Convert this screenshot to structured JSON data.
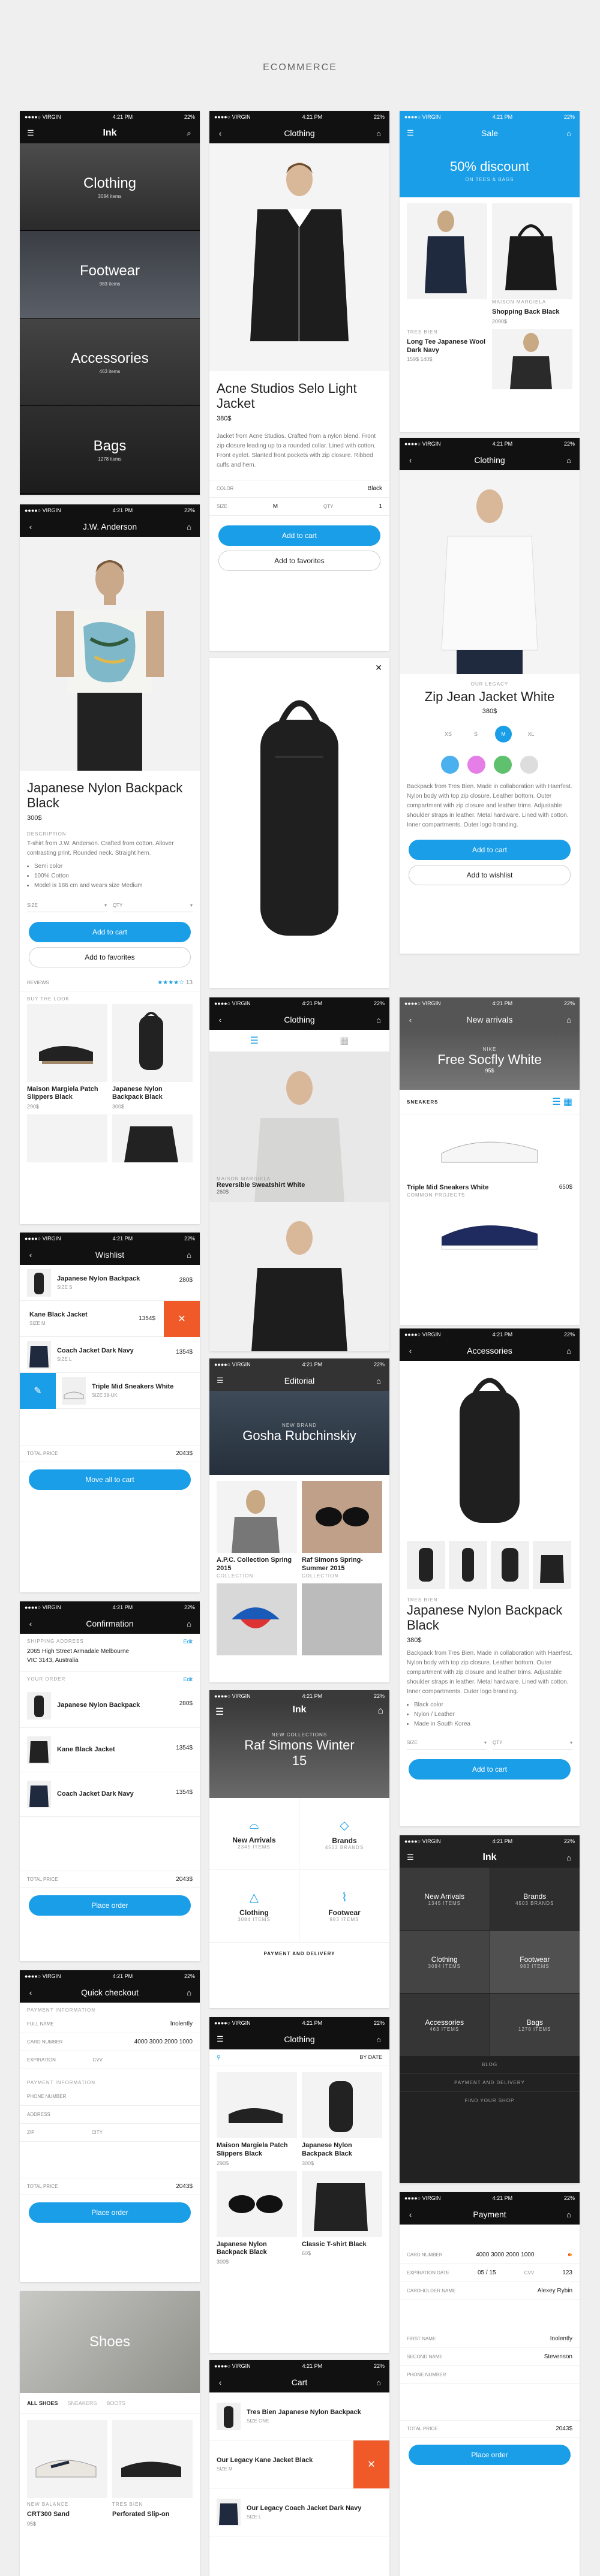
{
  "page_title": "ECOMMERCE",
  "status": {
    "carrier": "●●●●○ VIRGIN",
    "time": "4:21 PM",
    "battery": "22%"
  },
  "brand": "Ink",
  "categories_screen": {
    "items": [
      {
        "name": "Clothing",
        "count": "3084 items"
      },
      {
        "name": "Footwear",
        "count": "983 items"
      },
      {
        "name": "Accessories",
        "count": "463 items"
      },
      {
        "name": "Bags",
        "count": "1278 items"
      }
    ]
  },
  "product_screen": {
    "nav_title": "J.W. Anderson",
    "title": "Japanese Nylon Backpack Black",
    "price": "300$",
    "desc_label": "DESCRIPTION",
    "desc": "T-shirt from J.W. Anderson. Crafted from cotton. Allover contrasting print. Rounded neck. Straight hem.",
    "bullets": [
      "Semi color",
      "100% Cotton",
      "Model is 186 cm and wears size Medium"
    ],
    "size_label": "SIZE",
    "qty_label": "QTY",
    "add_cart": "Add to cart",
    "add_fav": "Add to favorites",
    "reviews_label": "REVIEWS",
    "reviews_count": "13",
    "look_label": "BUY THE LOOK",
    "look_items": [
      {
        "name": "Maison Margiela Patch Slippers Black",
        "price": "290$"
      },
      {
        "name": "Japanese Nylon Backpack Black",
        "price": "300$"
      }
    ]
  },
  "wishlist_screen": {
    "nav_title": "Wishlist",
    "items": [
      {
        "name": "Japanese Nylon Backpack",
        "sub": "SIZE S",
        "price": "280$"
      },
      {
        "name": "Kane Black Jacket",
        "sub": "SIZE M",
        "price": "1354$"
      },
      {
        "name": "Coach Jacket Dark Navy",
        "sub": "SIZE L",
        "price": "1354$"
      },
      {
        "name": "Triple Mid Sneakers White",
        "sub": "SIZE 38-UK",
        "price": ""
      }
    ],
    "total_label": "TOTAL PRICE",
    "total": "2043$",
    "move_all": "Move all to cart"
  },
  "confirm_screen": {
    "nav_title": "Confirmation",
    "shipping_label": "SHIPPING ADDRESS",
    "edit": "Edit",
    "address": "2065 High Street Armadale Melbourne VIC 3143, Australia",
    "order_label": "YOUR ORDER",
    "items": [
      {
        "name": "Japanese Nylon Backpack",
        "price": "280$"
      },
      {
        "name": "Kane Black Jacket",
        "price": "1354$"
      },
      {
        "name": "Coach Jacket Dark Navy",
        "price": "1354$"
      }
    ],
    "total_label": "TOTAL PRICE",
    "total": "2043$",
    "place": "Place order"
  },
  "quick_screen": {
    "nav_title": "Quick checkout",
    "payment_label": "PAYMENT INFORMATION",
    "full_name_label": "FULL NAME",
    "full_name": "Inolently",
    "card_label": "CARD NUMBER",
    "card": "4000 3000 2000 1000",
    "exp_label": "EXPIRATION",
    "cvv_label": "CVV",
    "ship_label": "PAYMENT INFORMATION",
    "phone_label": "PHONE NUMBER",
    "address_label": "ADDRESS",
    "zip_label": "ZIP",
    "city_label": "CITY",
    "total_label": "TOTAL PRICE",
    "total": "2043$",
    "place": "Place order"
  },
  "shoes_screen": {
    "hero": "Shoes",
    "tabs": [
      "ALL SHOES",
      "SNEAKERS",
      "BOOTS"
    ],
    "items": [
      {
        "brand": "NEW BALANCE",
        "name": "CRT300 Sand",
        "price": "95$"
      },
      {
        "brand": "TRES BIEN",
        "name": "Perforated Slip-on",
        "price": ""
      }
    ]
  },
  "jacket_screen": {
    "nav_title": "Clothing",
    "title": "Acne Studios Selo Light Jacket",
    "price": "380$",
    "desc": "Jacket from Acne Studios. Crafted from a nylon blend. Front zip closure leading up to a rounded collar. Lined with cotton. Front eyelet. Slanted front pockets with zip closure. Ribbed cuffs and hem.",
    "color_label": "COLOR",
    "color": "Black",
    "size_label": "SIZE",
    "size": "M",
    "qty_label": "QTY",
    "qty": "1",
    "add_cart": "Add to cart",
    "add_fav": "Add to favorites"
  },
  "backpack_preview": {
    "caption": "Reversible Sweatshirt White"
  },
  "clothing_list_screen": {
    "nav_title": "Clothing",
    "items": [
      {
        "brand": "MAISON MARGIELA",
        "name": "Reversible Sweatshirt White",
        "price": "260$"
      },
      {
        "brand": "",
        "name": "",
        "price": ""
      }
    ]
  },
  "editorial_screen": {
    "nav_title": "Editorial",
    "hero_label": "NEW BRAND",
    "hero": "Gosha Rubchinskiy",
    "items": [
      {
        "name": "A.P.C. Collection Spring 2015",
        "sub": "COLLECTION"
      },
      {
        "name": "Raf Simons Spring-Summer 2015",
        "sub": "COLLECTION"
      }
    ]
  },
  "home_screen": {
    "hero_label": "NEW COLLECTIONS",
    "hero": "Raf Simons Winter 15",
    "items": [
      {
        "name": "New Arrivals",
        "count": "2345 items"
      },
      {
        "name": "Brands",
        "count": "4503 brands"
      },
      {
        "name": "Clothing",
        "count": "3084 items"
      },
      {
        "name": "Footwear",
        "count": "983 items"
      }
    ],
    "footer": "PAYMENT AND DELIVERY"
  },
  "clothing_grid_screen": {
    "nav_title": "Clothing",
    "sort": "BY DATE",
    "items": [
      {
        "name": "Maison Margiela Patch Slippers Black",
        "price": "290$"
      },
      {
        "name": "Japanese Nylon Backpack Black",
        "price": "300$"
      },
      {
        "name": "Japanese Nylon Backpack Black",
        "price": "300$"
      },
      {
        "name": "Classic T-shirt Black",
        "price": "60$"
      }
    ]
  },
  "cart_screen": {
    "nav_title": "Cart",
    "items": [
      {
        "name": "Tres Bien Japanese Nylon Backpack",
        "sub": "SIZE ONE",
        "price": ""
      },
      {
        "name": "Our Legacy Kane Jacket Black",
        "sub": "SIZE M",
        "price": ""
      },
      {
        "name": "Our Legacy Coach Jacket Dark Navy",
        "sub": "SIZE L",
        "price": ""
      }
    ]
  },
  "sale_screen": {
    "nav_title": "Sale",
    "banner": "50% discount",
    "banner_sub": "ON TEES & BAGS",
    "items": [
      {
        "brand": "",
        "name": "",
        "price": ""
      },
      {
        "brand": "MAISON MARGIELA",
        "name": "Shopping Back Black",
        "price": "2090$"
      },
      {
        "brand": "TRES BIEN",
        "name": "Long Tee Japanese Wool Dark Navy",
        "price": "159$ 140$"
      },
      {
        "brand": "",
        "name": "",
        "price": ""
      }
    ]
  },
  "white_jacket_screen": {
    "nav_title": "Clothing",
    "brand": "OUR LEGACY",
    "title": "Zip Jean Jacket White",
    "price": "380$",
    "sizes": [
      "XS",
      "S",
      "M",
      "XL"
    ],
    "selected_size": "M",
    "colors": [
      "#4bb0ee",
      "#e57ee6",
      "#5fc16d",
      "#dddddd"
    ],
    "desc": "Backpack from Tres Bien. Made in collaboration with Haerfest. Nylon body with top zip closure. Leather bottom. Outer compartment with zip closure and leather trims. Adjustable shoulder straps in leather. Metal hardware. Lined with cotton. Inner compartments. Outer logo branding.",
    "add_cart": "Add to cart",
    "add_wish": "Add to wishlist"
  },
  "new_arrivals_screen": {
    "nav_title": "New arrivals",
    "hero_label": "NIKE",
    "hero": "Free Socfly White",
    "hero_price": "95$",
    "tab": "SNEAKERS",
    "items": [
      {
        "name": "Triple Mid Sneakers White",
        "brand": "COMMON PROJECTS",
        "price": "650$"
      }
    ]
  },
  "accessories_screen": {
    "nav_title": "Accessories",
    "brand": "TRES BIEN",
    "title": "Japanese Nylon Backpack Black",
    "price": "380$",
    "desc": "Backpack from Tres Bien. Made in collaboration with Haerfest. Nylon body with top zip closure. Leather bottom. Outer compartment with zip closure and leather trims. Adjustable shoulder straps in leather. Metal hardware. Lined with cotton. Inner compartments. Outer logo branding.",
    "bullets": [
      "Black color",
      "Nylon / Leather",
      "Made in South Korea"
    ],
    "size_label": "SIZE",
    "qty_label": "QTY",
    "add_cart": "Add to cart"
  },
  "dark_home_screen": {
    "items": [
      {
        "name": "New Arrivals",
        "count": "1345 items"
      },
      {
        "name": "Brands",
        "count": "4503 brands"
      },
      {
        "name": "Clothing",
        "count": "3084 items"
      },
      {
        "name": "Footwear",
        "count": "983 items"
      },
      {
        "name": "Accessories",
        "count": "463 items"
      },
      {
        "name": "Bags",
        "count": "1278 items"
      }
    ],
    "links": [
      "BLOG",
      "PAYMENT AND DELIVERY",
      "FIND YOUR SHOP"
    ]
  },
  "payment_screen": {
    "nav_title": "Payment",
    "card_label": "CARD NUMBER",
    "card": "4000 3000 2000 1000",
    "exp_label": "EXPIRATION DATE",
    "exp": "05 / 15",
    "cvv_label": "CVV",
    "cvv": "123",
    "holder_label": "CARDHOLDER NAME",
    "holder": "Alexey Rybin",
    "first_label": "FIRST NAME",
    "first": "Inolently",
    "second_label": "SECOND NAME",
    "second": "Stevenson",
    "phone_label": "PHONE NUMBER",
    "total_label": "TOTAL PRICE",
    "total": "2043$",
    "place": "Place order"
  }
}
